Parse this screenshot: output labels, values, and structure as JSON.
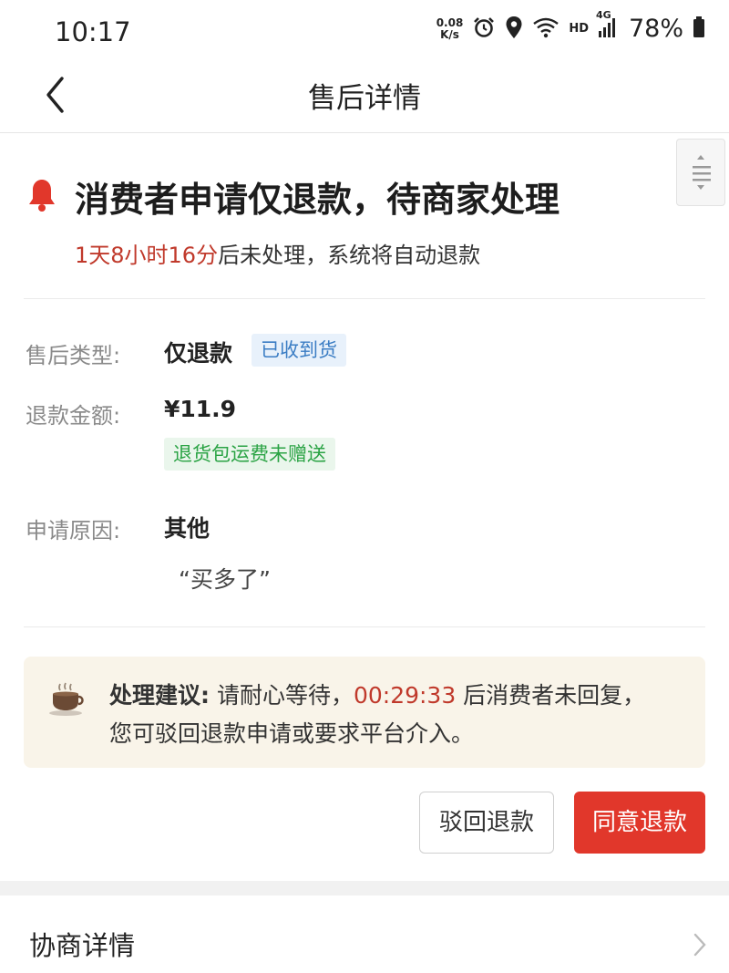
{
  "status_bar": {
    "time": "10:17",
    "net_speed_value": "0.08",
    "net_speed_unit": "K/s",
    "network_label": "HD",
    "signal_label": "4G",
    "battery": "78%"
  },
  "nav": {
    "title": "售后详情"
  },
  "header": {
    "title": "消费者申请仅退款，待商家处理",
    "countdown": "1天8小时16分",
    "countdown_suffix": "后未处理，系统将自动退款"
  },
  "details": {
    "type_label": "售后类型:",
    "type_value": "仅退款",
    "type_tag": "已收到货",
    "amount_label": "退款金额:",
    "amount_value": "¥11.9",
    "amount_tag": "退货包运费未赠送",
    "reason_label": "申请原因:",
    "reason_value": "其他",
    "reason_quote": "“买多了”"
  },
  "suggestion": {
    "label": "处理建议:",
    "text_before": " 请耐心等待，",
    "time": "00:29:33",
    "text_after": " 后消费者未回复，您可驳回退款申请或要求平台介入。"
  },
  "actions": {
    "reject_label": "驳回退款",
    "agree_label": "同意退款"
  },
  "negotiation": {
    "label": "协商详情"
  },
  "colors": {
    "accent_red": "#e1372b",
    "countdown_red": "#c0392b",
    "tag_blue": "#3b7dc4",
    "tag_green": "#2aa344",
    "suggest_bg": "#f9f4e9"
  }
}
